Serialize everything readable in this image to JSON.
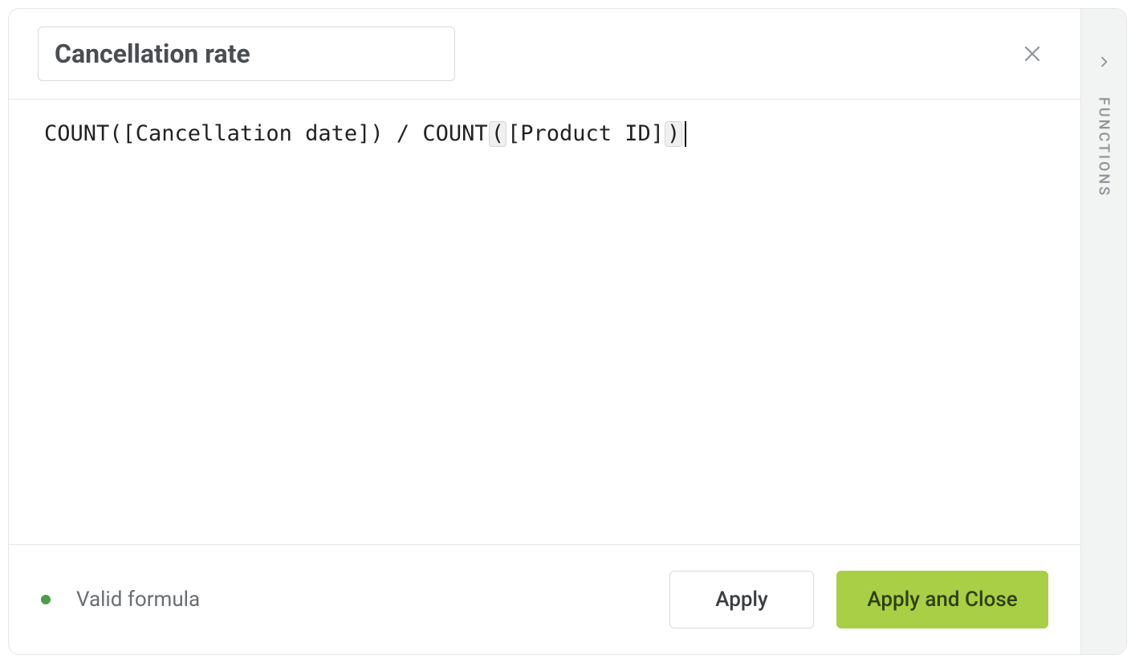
{
  "header": {
    "name_value": "Cancellation rate",
    "close_icon": "close-icon"
  },
  "formula": {
    "segments": [
      {
        "t": "plain",
        "v": "COUNT([Cancellation date]) / COUNT"
      },
      {
        "t": "bracket",
        "v": "("
      },
      {
        "t": "plain",
        "v": "[Product ID]"
      },
      {
        "t": "bracket",
        "v": ")"
      }
    ],
    "caret_after": true
  },
  "footer": {
    "status_text": "Valid formula",
    "status_valid": true,
    "apply_label": "Apply",
    "apply_close_label": "Apply and Close"
  },
  "sidebar": {
    "panel_label": "FUNCTIONS",
    "expand_icon": "chevron-right-icon"
  },
  "colors": {
    "primary_button_bg": "#a8cf45",
    "valid_dot": "#4aa04a"
  }
}
